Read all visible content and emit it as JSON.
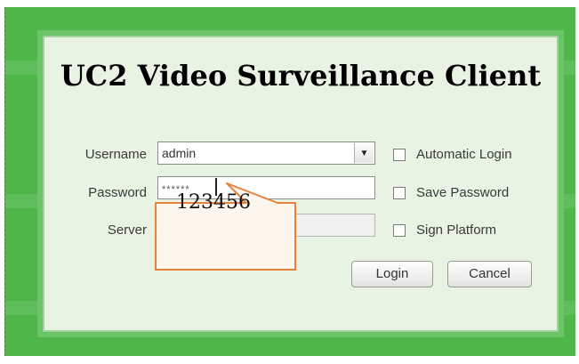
{
  "dialog": {
    "title": "UC2 Video Surveillance Client"
  },
  "form": {
    "username_label": "Username",
    "username_value": "admin",
    "password_label": "Password",
    "password_value": "******",
    "server_label": "Server",
    "server_value": ""
  },
  "options": {
    "automatic_login": {
      "label": "Automatic Login",
      "checked": false
    },
    "save_password": {
      "label": "Save Password",
      "checked": false
    },
    "sign_platform": {
      "label": "Sign Platform",
      "checked": false
    }
  },
  "buttons": {
    "login": "Login",
    "cancel": "Cancel"
  },
  "callout": {
    "text": "123456"
  },
  "colors": {
    "background_green": "#4fb64a",
    "dialog_bg": "#e8f3e4",
    "callout_fill": "#fdf6ee",
    "callout_border": "#e6823a"
  },
  "icons": {
    "combo_arrow": "chevron-down-icon"
  }
}
